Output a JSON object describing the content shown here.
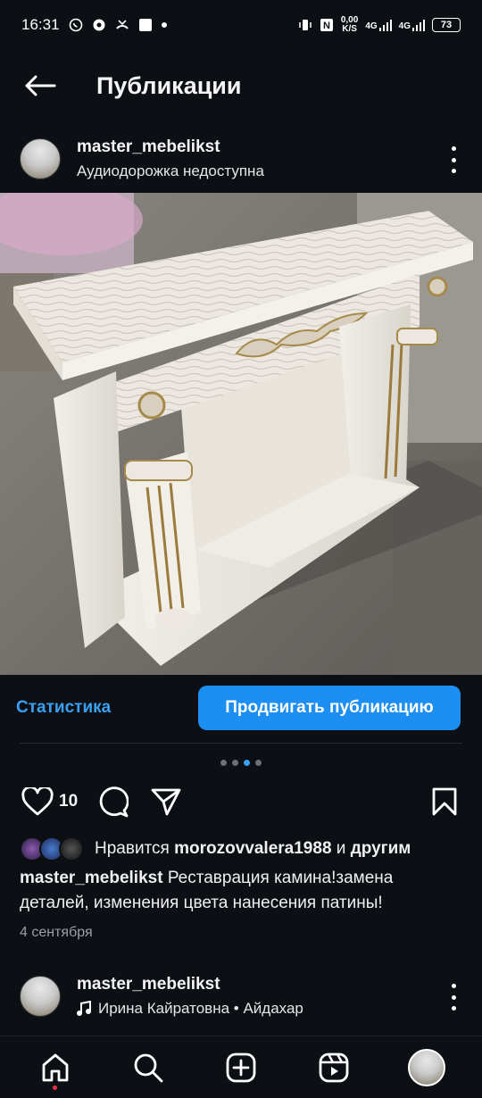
{
  "status_bar": {
    "time": "16:31",
    "network_speed_top": "0,00",
    "network_speed_unit": "K/S",
    "network_1": "4G",
    "network_2": "4G",
    "battery": "73"
  },
  "top_bar": {
    "title": "Публикации"
  },
  "post": {
    "username": "master_mebelikst",
    "audio_status": "Аудиодорожка недоступна",
    "statistics_label": "Статистика",
    "promote_label": "Продвигать публикацию",
    "carousel_count": 4,
    "carousel_active_index": 2,
    "like_count": "10",
    "liked_by_prefix": "Нравится",
    "liked_by_user": "morozovvalera1988",
    "liked_by_and": "и",
    "liked_by_others": "другим",
    "caption_user": "master_mebelikst",
    "caption_text": "Реставрация камина!замена деталей, изменения цвета нанесения патины!",
    "date": "4 сентября"
  },
  "next_post": {
    "username": "master_mebelikst",
    "audio": "Ирина Кайратовна • Айдахар"
  },
  "colors": {
    "background": "#0c0f14",
    "accent_blue": "#1d8ff2",
    "link_blue": "#3aa0f2",
    "notification_red": "#ff3040"
  },
  "icons": {
    "back": "arrow-left-icon",
    "more": "more-vertical-icon",
    "like": "heart-icon",
    "comment": "comment-icon",
    "share": "send-icon",
    "save": "bookmark-icon",
    "music": "music-note-icon",
    "home": "home-icon",
    "search": "search-icon",
    "create": "plus-square-icon",
    "reels": "reels-icon"
  }
}
